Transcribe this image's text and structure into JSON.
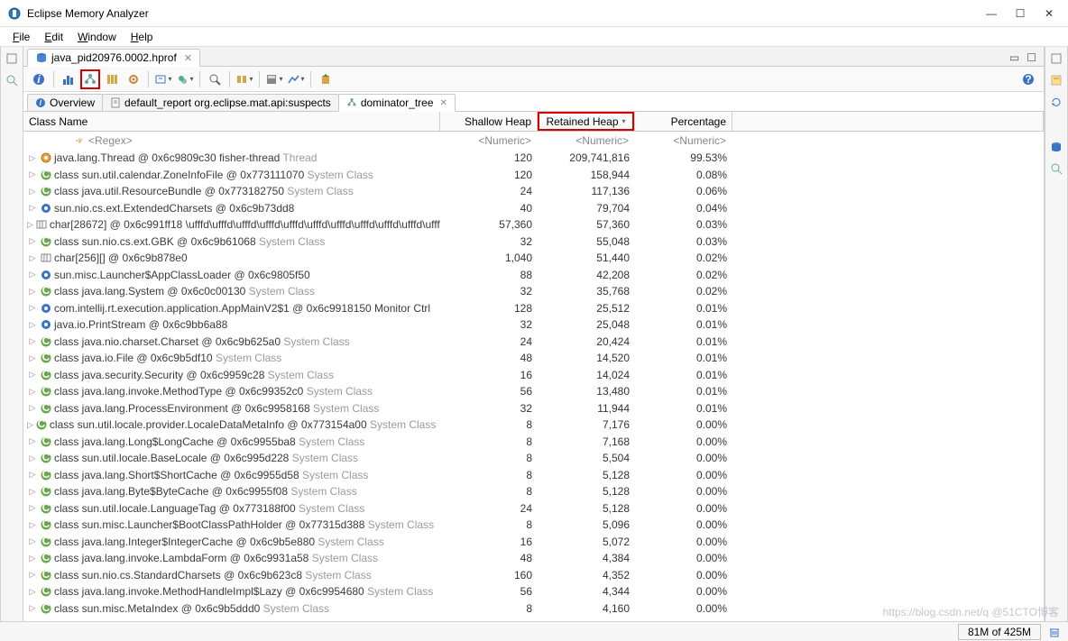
{
  "window": {
    "title": "Eclipse Memory Analyzer"
  },
  "menu": [
    "File",
    "Edit",
    "Window",
    "Help"
  ],
  "editor_tab": {
    "label": "java_pid20976.0002.hprof"
  },
  "inner_tabs": [
    {
      "icon": "info",
      "label": "Overview"
    },
    {
      "icon": "report",
      "label": "default_report  org.eclipse.mat.api:suspects"
    },
    {
      "icon": "tree",
      "label": "dominator_tree",
      "active": true
    }
  ],
  "columns": {
    "class": "Class Name",
    "shallow": "Shallow Heap",
    "retained": "Retained Heap",
    "percentage": "Percentage"
  },
  "filters": {
    "regex": "<Regex>",
    "numeric": "<Numeric>"
  },
  "rows": [
    {
      "icon": "thread",
      "name": "java.lang.Thread @ 0x6c9809c30  fisher-thread",
      "suffix": "Thread",
      "shallow": "120",
      "retained": "209,741,816",
      "pct": "99.53%"
    },
    {
      "icon": "class",
      "name": "class sun.util.calendar.ZoneInfoFile @ 0x773111070",
      "suffix": "System Class",
      "shallow": "120",
      "retained": "158,944",
      "pct": "0.08%"
    },
    {
      "icon": "class",
      "name": "class java.util.ResourceBundle @ 0x773182750",
      "suffix": "System Class",
      "shallow": "24",
      "retained": "117,136",
      "pct": "0.06%"
    },
    {
      "icon": "obj",
      "name": "sun.nio.cs.ext.ExtendedCharsets @ 0x6c9b73dd8",
      "suffix": "",
      "shallow": "40",
      "retained": "79,704",
      "pct": "0.04%"
    },
    {
      "icon": "array",
      "name": "char[28672] @ 0x6c991ff18  \\ufffd\\ufffd\\ufffd\\ufffd\\ufffd\\ufffd\\ufffd\\ufffd\\ufffd\\ufffd\\ufffd\\",
      "suffix": "",
      "shallow": "57,360",
      "retained": "57,360",
      "pct": "0.03%"
    },
    {
      "icon": "class",
      "name": "class sun.nio.cs.ext.GBK @ 0x6c9b61068",
      "suffix": "System Class",
      "shallow": "32",
      "retained": "55,048",
      "pct": "0.03%"
    },
    {
      "icon": "array",
      "name": "char[256][] @ 0x6c9b878e0",
      "suffix": "",
      "shallow": "1,040",
      "retained": "51,440",
      "pct": "0.02%"
    },
    {
      "icon": "obj",
      "name": "sun.misc.Launcher$AppClassLoader @ 0x6c9805f50",
      "suffix": "",
      "shallow": "88",
      "retained": "42,208",
      "pct": "0.02%"
    },
    {
      "icon": "class",
      "name": "class java.lang.System @ 0x6c0c00130",
      "suffix": "System Class",
      "shallow": "32",
      "retained": "35,768",
      "pct": "0.02%"
    },
    {
      "icon": "obj",
      "name": "com.intellij.rt.execution.application.AppMainV2$1 @ 0x6c9918150  Monitor Ctrl",
      "suffix": "",
      "shallow": "128",
      "retained": "25,512",
      "pct": "0.01%"
    },
    {
      "icon": "obj",
      "name": "java.io.PrintStream @ 0x6c9bb6a88",
      "suffix": "",
      "shallow": "32",
      "retained": "25,048",
      "pct": "0.01%"
    },
    {
      "icon": "class",
      "name": "class java.nio.charset.Charset @ 0x6c9b625a0",
      "suffix": "System Class",
      "shallow": "24",
      "retained": "20,424",
      "pct": "0.01%"
    },
    {
      "icon": "class",
      "name": "class java.io.File @ 0x6c9b5df10",
      "suffix": "System Class",
      "shallow": "48",
      "retained": "14,520",
      "pct": "0.01%"
    },
    {
      "icon": "class",
      "name": "class java.security.Security @ 0x6c9959c28",
      "suffix": "System Class",
      "shallow": "16",
      "retained": "14,024",
      "pct": "0.01%"
    },
    {
      "icon": "class",
      "name": "class java.lang.invoke.MethodType @ 0x6c99352c0",
      "suffix": "System Class",
      "shallow": "56",
      "retained": "13,480",
      "pct": "0.01%"
    },
    {
      "icon": "class",
      "name": "class java.lang.ProcessEnvironment @ 0x6c9958168",
      "suffix": "System Class",
      "shallow": "32",
      "retained": "11,944",
      "pct": "0.01%"
    },
    {
      "icon": "class",
      "name": "class sun.util.locale.provider.LocaleDataMetaInfo @ 0x773154a00",
      "suffix": "System Class",
      "shallow": "8",
      "retained": "7,176",
      "pct": "0.00%"
    },
    {
      "icon": "class",
      "name": "class java.lang.Long$LongCache @ 0x6c9955ba8",
      "suffix": "System Class",
      "shallow": "8",
      "retained": "7,168",
      "pct": "0.00%"
    },
    {
      "icon": "class",
      "name": "class sun.util.locale.BaseLocale @ 0x6c995d228",
      "suffix": "System Class",
      "shallow": "8",
      "retained": "5,504",
      "pct": "0.00%"
    },
    {
      "icon": "class",
      "name": "class java.lang.Short$ShortCache @ 0x6c9955d58",
      "suffix": "System Class",
      "shallow": "8",
      "retained": "5,128",
      "pct": "0.00%"
    },
    {
      "icon": "class",
      "name": "class java.lang.Byte$ByteCache @ 0x6c9955f08",
      "suffix": "System Class",
      "shallow": "8",
      "retained": "5,128",
      "pct": "0.00%"
    },
    {
      "icon": "class",
      "name": "class sun.util.locale.LanguageTag @ 0x773188f00",
      "suffix": "System Class",
      "shallow": "24",
      "retained": "5,128",
      "pct": "0.00%"
    },
    {
      "icon": "class",
      "name": "class sun.misc.Launcher$BootClassPathHolder @ 0x77315d388",
      "suffix": "System Class",
      "shallow": "8",
      "retained": "5,096",
      "pct": "0.00%"
    },
    {
      "icon": "class",
      "name": "class java.lang.Integer$IntegerCache @ 0x6c9b5e880",
      "suffix": "System Class",
      "shallow": "16",
      "retained": "5,072",
      "pct": "0.00%"
    },
    {
      "icon": "class",
      "name": "class java.lang.invoke.LambdaForm @ 0x6c9931a58",
      "suffix": "System Class",
      "shallow": "48",
      "retained": "4,384",
      "pct": "0.00%"
    },
    {
      "icon": "class",
      "name": "class sun.nio.cs.StandardCharsets @ 0x6c9b623c8",
      "suffix": "System Class",
      "shallow": "160",
      "retained": "4,352",
      "pct": "0.00%"
    },
    {
      "icon": "class",
      "name": "class java.lang.invoke.MethodHandleImpl$Lazy @ 0x6c9954680",
      "suffix": "System Class",
      "shallow": "56",
      "retained": "4,344",
      "pct": "0.00%"
    },
    {
      "icon": "class",
      "name": "class sun.misc.MetaIndex @ 0x6c9b5ddd0",
      "suffix": "System Class",
      "shallow": "8",
      "retained": "4,160",
      "pct": "0.00%"
    }
  ],
  "status": {
    "memory": "81M of 425M"
  },
  "watermark": "https://blog.csdn.net/q @51CTO博客"
}
